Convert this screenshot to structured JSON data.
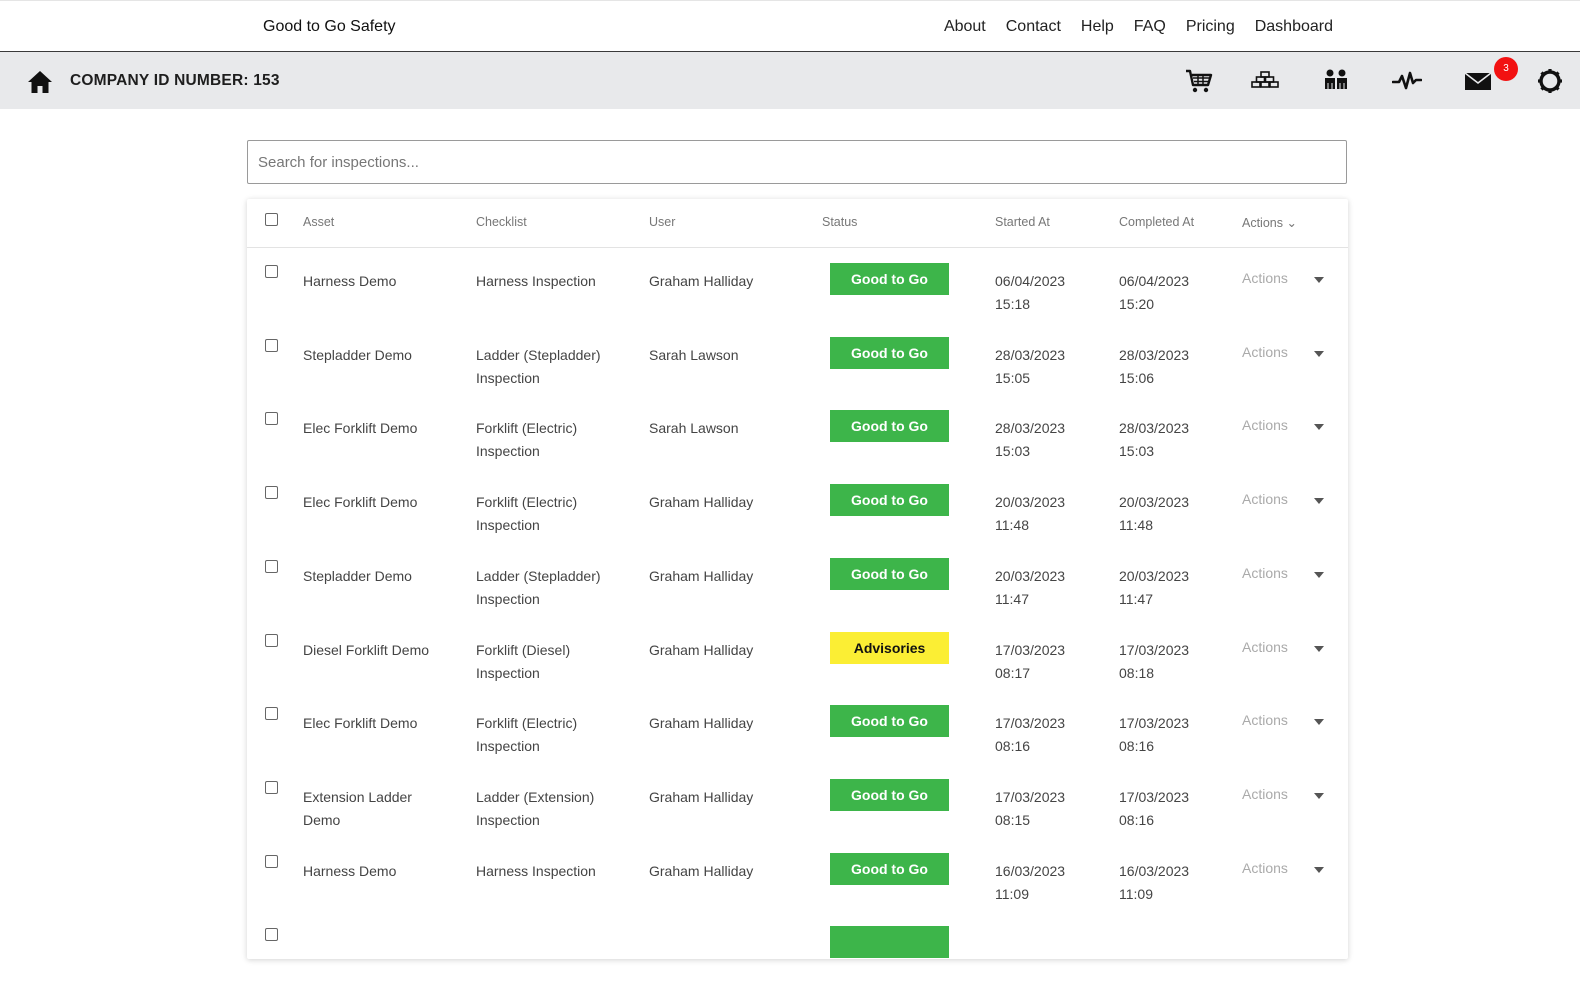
{
  "brand": "Good to Go Safety",
  "nav": [
    "About",
    "Contact",
    "Help",
    "FAQ",
    "Pricing",
    "Dashboard"
  ],
  "company_label": "COMPANY ID NUMBER: 153",
  "mail_badge": "3",
  "search": {
    "placeholder": "Search for inspections..."
  },
  "table": {
    "headers": {
      "asset": "Asset",
      "checklist": "Checklist",
      "user": "User",
      "status": "Status",
      "started": "Started At",
      "completed": "Completed At",
      "actions": "Actions ⌄"
    },
    "action_label": "Actions",
    "rows": [
      {
        "asset": [
          "Harness Demo"
        ],
        "checklist": [
          "Harness Inspection"
        ],
        "user": "Graham Halliday",
        "status": "Good to Go",
        "status_type": "good",
        "started": [
          "06/04/2023",
          "15:18"
        ],
        "completed": [
          "06/04/2023",
          "15:20"
        ]
      },
      {
        "asset": [
          "Stepladder Demo"
        ],
        "checklist": [
          "Ladder (Stepladder)",
          "Inspection"
        ],
        "user": "Sarah Lawson",
        "status": "Good to Go",
        "status_type": "good",
        "started": [
          "28/03/2023",
          "15:05"
        ],
        "completed": [
          "28/03/2023",
          "15:06"
        ]
      },
      {
        "asset": [
          "Elec Forklift Demo"
        ],
        "checklist": [
          "Forklift (Electric)",
          "Inspection"
        ],
        "user": "Sarah Lawson",
        "status": "Good to Go",
        "status_type": "good",
        "started": [
          "28/03/2023",
          "15:03"
        ],
        "completed": [
          "28/03/2023",
          "15:03"
        ]
      },
      {
        "asset": [
          "Elec Forklift Demo"
        ],
        "checklist": [
          "Forklift (Electric)",
          "Inspection"
        ],
        "user": "Graham Halliday",
        "status": "Good to Go",
        "status_type": "good",
        "started": [
          "20/03/2023",
          "11:48"
        ],
        "completed": [
          "20/03/2023",
          "11:48"
        ]
      },
      {
        "asset": [
          "Stepladder Demo"
        ],
        "checklist": [
          "Ladder (Stepladder)",
          "Inspection"
        ],
        "user": "Graham Halliday",
        "status": "Good to Go",
        "status_type": "good",
        "started": [
          "20/03/2023",
          "11:47"
        ],
        "completed": [
          "20/03/2023",
          "11:47"
        ]
      },
      {
        "asset": [
          "Diesel Forklift Demo"
        ],
        "checklist": [
          "Forklift (Diesel)",
          "Inspection"
        ],
        "user": "Graham Halliday",
        "status": "Advisories",
        "status_type": "adv",
        "started": [
          "17/03/2023",
          "08:17"
        ],
        "completed": [
          "17/03/2023",
          "08:18"
        ]
      },
      {
        "asset": [
          "Elec Forklift Demo"
        ],
        "checklist": [
          "Forklift (Electric)",
          "Inspection"
        ],
        "user": "Graham Halliday",
        "status": "Good to Go",
        "status_type": "good",
        "started": [
          "17/03/2023",
          "08:16"
        ],
        "completed": [
          "17/03/2023",
          "08:16"
        ]
      },
      {
        "asset": [
          "Extension Ladder",
          "Demo"
        ],
        "checklist": [
          "Ladder (Extension)",
          "Inspection"
        ],
        "user": "Graham Halliday",
        "status": "Good to Go",
        "status_type": "good",
        "started": [
          "17/03/2023",
          "08:15"
        ],
        "completed": [
          "17/03/2023",
          "08:16"
        ]
      },
      {
        "asset": [
          "Harness Demo"
        ],
        "checklist": [
          "Harness Inspection"
        ],
        "user": "Graham Halliday",
        "status": "Good to Go",
        "status_type": "good",
        "started": [
          "16/03/2023",
          "11:09"
        ],
        "completed": [
          "16/03/2023",
          "11:09"
        ]
      },
      {
        "asset": [
          ""
        ],
        "checklist": [
          ""
        ],
        "user": "",
        "status": "",
        "status_type": "good",
        "started": [
          "",
          ""
        ],
        "completed": [
          "",
          ""
        ]
      }
    ]
  },
  "icons": {
    "home": "home-icon",
    "cart": "cart-icon",
    "assets": "stack-icon",
    "users": "users-icon",
    "activity": "activity-icon",
    "mail": "mail-icon",
    "settings": "gear-icon"
  },
  "colors": {
    "good": "#3db54a",
    "advisory": "#fbee34",
    "badge": "#f21111"
  }
}
